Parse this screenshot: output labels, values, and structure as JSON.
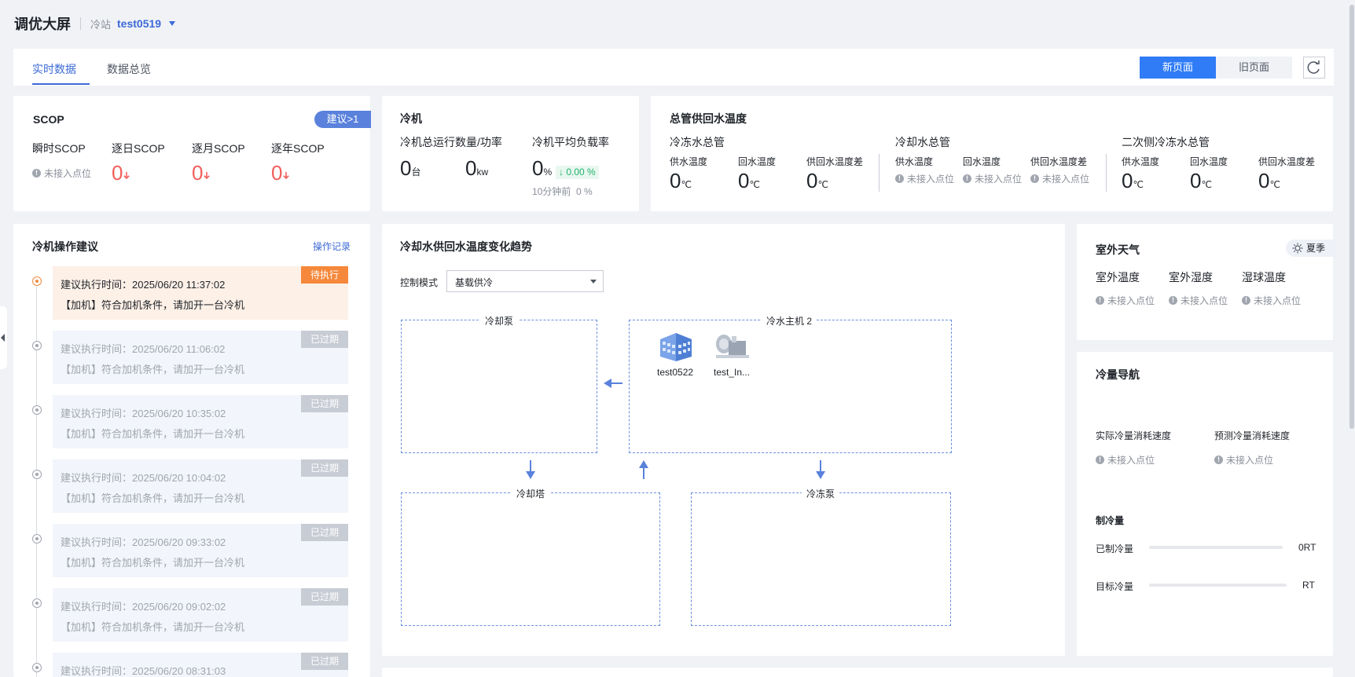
{
  "header": {
    "title": "调优大屏",
    "station_label": "冷站",
    "station_value": "test0519"
  },
  "tabs": [
    {
      "label": "实时数据",
      "active": true
    },
    {
      "label": "数据总览",
      "active": false
    }
  ],
  "page_switch": {
    "new_label": "新页面",
    "old_label": "旧页面"
  },
  "not_connected": "未接入点位",
  "scop": {
    "title": "SCOP",
    "badge": "建议>1",
    "instant_label": "瞬时SCOP",
    "daily_label": "逐日SCOP",
    "daily_value": "0",
    "monthly_label": "逐月SCOP",
    "monthly_value": "0",
    "yearly_label": "逐年SCOP",
    "yearly_value": "0"
  },
  "chiller": {
    "title": "冷机",
    "count_label": "冷机总运行数量/功率",
    "count_value": "0",
    "count_unit": "台",
    "power_value": "0",
    "power_unit": "kw",
    "load_label": "冷机平均负载率",
    "load_value": "0",
    "load_unit": "%",
    "load_change": "0.00 %",
    "ten_min_label": "10分钟前",
    "ten_min_value": "0 %"
  },
  "supply_return": {
    "title": "总管供回水温度",
    "chilled": {
      "title": "冷冻水总管",
      "supply_label": "供水温度",
      "supply_value": "0",
      "return_label": "回水温度",
      "return_value": "0",
      "diff_label": "供回水温度差",
      "diff_value": "0"
    },
    "cooling": {
      "title": "冷却水总管",
      "supply_label": "供水温度",
      "return_label": "回水温度",
      "diff_label": "供回水温度差"
    },
    "secondary": {
      "title": "二次侧冷冻水总管",
      "supply_label": "供水温度",
      "supply_value": "0",
      "return_label": "回水温度",
      "return_value": "0",
      "diff_label": "供回水温度差",
      "diff_value": "0"
    },
    "temp_unit": "℃"
  },
  "suggestions": {
    "title": "冷机操作建议",
    "log_link": "操作记录",
    "items": [
      {
        "time": "建议执行时间：2025/06/20 11:37:02",
        "msg": "【加机】符合加机条件，请加开一台冷机",
        "status": "待执行",
        "pending": true
      },
      {
        "time": "建议执行时间：2025/06/20 11:06:02",
        "msg": "【加机】符合加机条件，请加开一台冷机",
        "status": "已过期",
        "pending": false
      },
      {
        "time": "建议执行时间：2025/06/20 10:35:02",
        "msg": "【加机】符合加机条件，请加开一台冷机",
        "status": "已过期",
        "pending": false
      },
      {
        "time": "建议执行时间：2025/06/20 10:04:02",
        "msg": "【加机】符合加机条件，请加开一台冷机",
        "status": "已过期",
        "pending": false
      },
      {
        "time": "建议执行时间：2025/06/20 09:33:02",
        "msg": "【加机】符合加机条件，请加开一台冷机",
        "status": "已过期",
        "pending": false
      },
      {
        "time": "建议执行时间：2025/06/20 09:02:02",
        "msg": "【加机】符合加机条件，请加开一台冷机",
        "status": "已过期",
        "pending": false
      },
      {
        "time": "建议执行时间：2025/06/20 08:31:03",
        "msg": "",
        "status": "已过期",
        "pending": false
      }
    ]
  },
  "trend": {
    "title": "冷却水供回水温度变化趋势",
    "mode_label": "控制模式",
    "mode_value": "基载供冷",
    "cooling_pump": "冷却泵",
    "chiller_host": "冷水主机 2",
    "cooling_tower": "冷却塔",
    "chilled_pump": "冷冻泵",
    "device1": "test0522",
    "device2": "test_In..."
  },
  "weather": {
    "title": "室外天气",
    "season": "夏季",
    "outdoor_temp_label": "室外温度",
    "outdoor_humidity_label": "室外湿度",
    "wet_bulb_label": "湿球温度"
  },
  "cooling_nav": {
    "title": "冷量导航",
    "actual_label": "实际冷量消耗速度",
    "predicted_label": "预测冷量消耗速度",
    "capacity_title": "制冷量",
    "produced_label": "已制冷量",
    "produced_value": "0RT",
    "produced_fraction": 0,
    "target_label": "目标冷量",
    "target_value": "RT",
    "target_fraction": 0
  },
  "colors": {
    "accent": "#3d6ad6",
    "pending": "#f5883a",
    "red": "#f0605c",
    "green": "#20b26b"
  }
}
